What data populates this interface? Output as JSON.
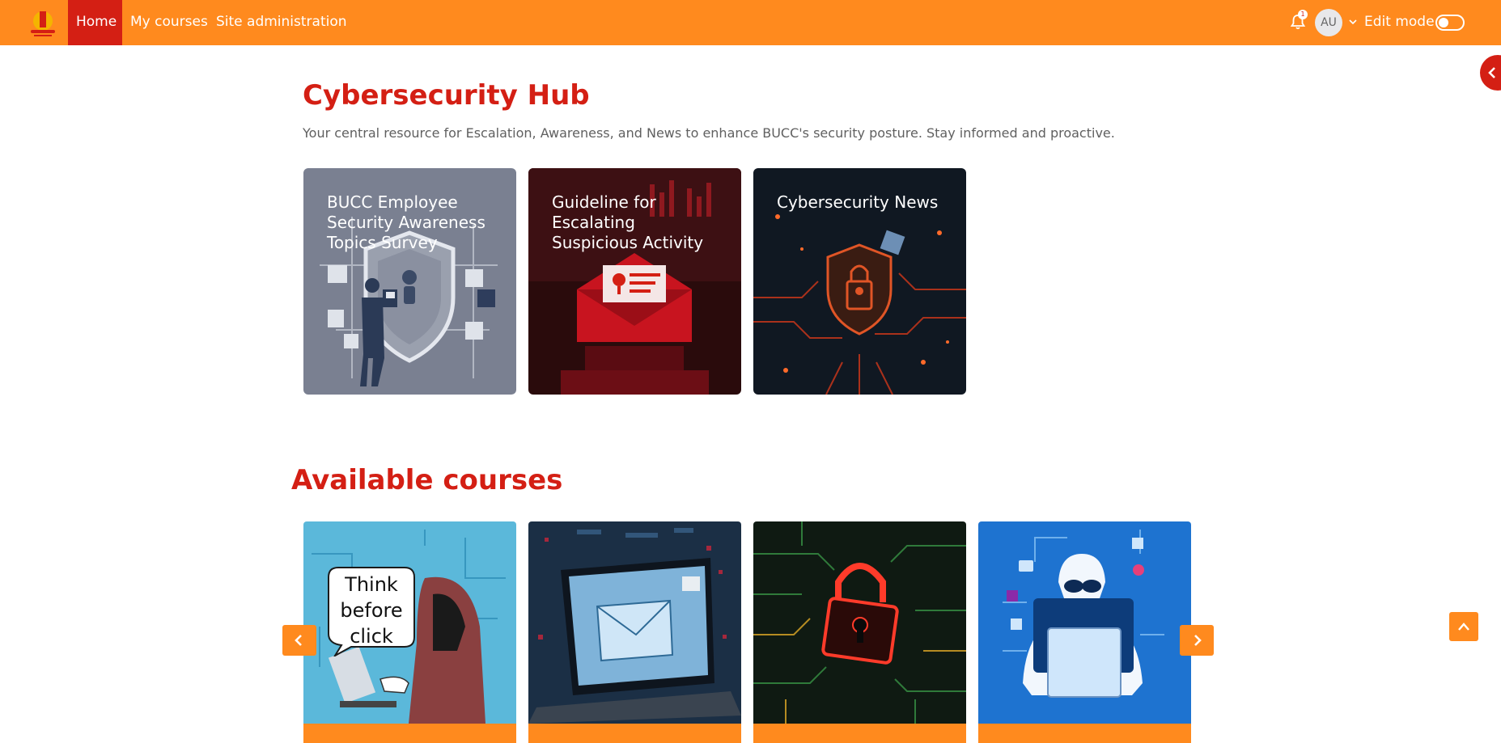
{
  "navbar": {
    "logo_icon": "site-logo",
    "items": [
      {
        "label": "Home",
        "active": true
      },
      {
        "label": "My courses",
        "active": false
      },
      {
        "label": "Site administration",
        "active": false
      }
    ],
    "notifications_count": "1",
    "avatar_initials": "AU",
    "edit_mode_label": "Edit mode",
    "edit_mode_on": false
  },
  "hub": {
    "title": "Cybersecurity Hub",
    "description": "Your central resource for Escalation, Awareness, and News to enhance BUCC's security posture. Stay informed and proactive.",
    "cards": [
      {
        "label": "BUCC Employee Security Awareness Topics Survey",
        "image": "security-shield-person-illustration"
      },
      {
        "label": "Guideline for Escalating Suspicious Activity",
        "image": "red-envelope-warning-illustration"
      },
      {
        "label": "Cybersecurity News",
        "image": "circuit-shield-lock-illustration"
      }
    ]
  },
  "courses": {
    "title": "Available courses",
    "cards": [
      {
        "image": "hooded-hacker-laptop-illustration",
        "caption": "Think before click"
      },
      {
        "image": "laptop-email-illustration"
      },
      {
        "image": "circuit-padlock-illustration"
      },
      {
        "image": "anonymous-user-laptop-illustration"
      }
    ]
  },
  "colors": {
    "brand_orange": "#ff8a1e",
    "brand_red": "#d41f14"
  }
}
